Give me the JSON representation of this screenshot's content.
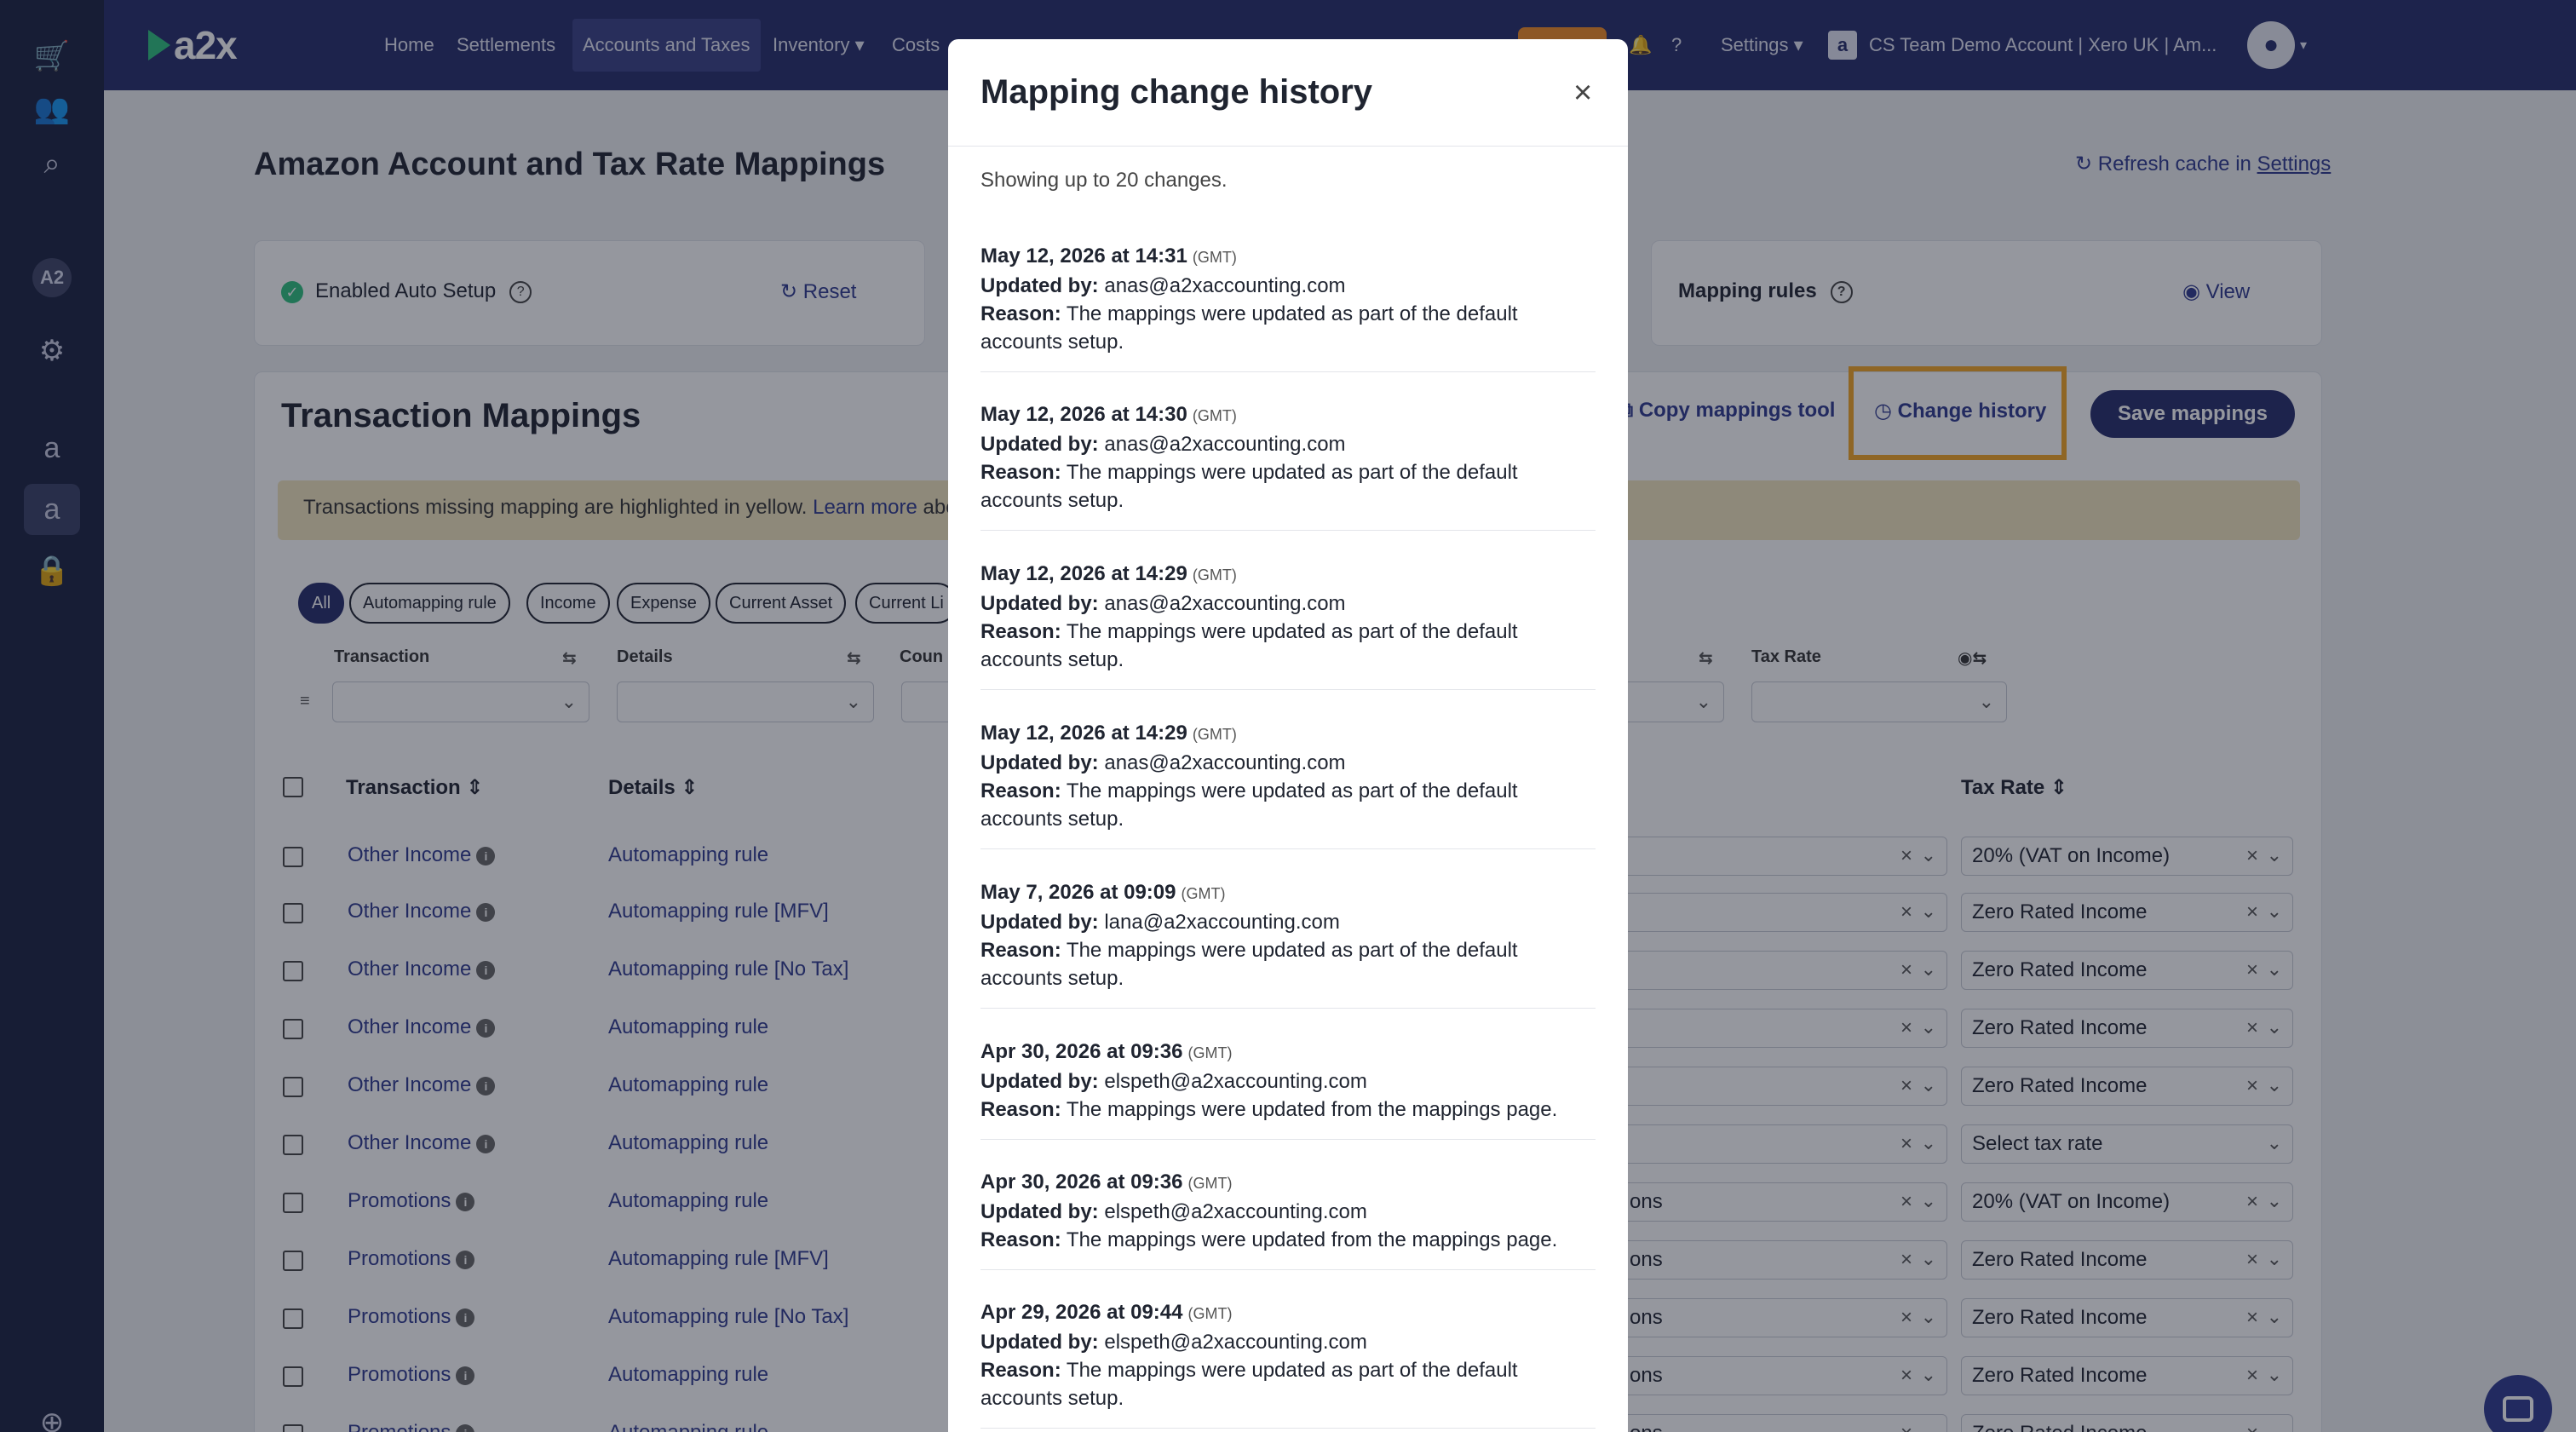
{
  "rail": {
    "icons": [
      "cart-icon",
      "users-icon",
      "search-icon",
      "a2-badge",
      "gear-icon",
      "amazon-icon",
      "amazon-store-icon",
      "lock-icon",
      "add-icon"
    ],
    "badge_label": "A2"
  },
  "nav": {
    "logo": "a2x",
    "items": [
      "Home",
      "Settlements",
      "Accounts and Taxes",
      "Inventory ▾",
      "Costs"
    ],
    "settings": "Settings ▾",
    "account": "CS Team Demo Account | Xero UK | Am..."
  },
  "page": {
    "title": "Amazon Account and Tax Rate Mappings",
    "refresh_prefix": "Refresh cache in ",
    "refresh_link": "Settings"
  },
  "auto_setup": {
    "label": "Enabled Auto Setup",
    "reset": "Reset"
  },
  "mapping_rules": {
    "label": "Mapping rules",
    "view": "View"
  },
  "transaction_mappings": {
    "title": "Transaction Mappings",
    "copy_tool": "Copy mappings tool",
    "change_history": "Change history",
    "save": "Save mappings",
    "banner_text": "Transactions missing mapping are highlighted in yellow. ",
    "banner_link": "Learn more",
    "banner_tail": " abo",
    "pills": [
      "All",
      "Automapping rule",
      "Income",
      "Expense",
      "Current Asset",
      "Current Li"
    ],
    "filters": {
      "transaction": "Transaction",
      "details": "Details",
      "count": "Coun",
      "tax_rate": "Tax Rate"
    },
    "columns": {
      "transaction": "Transaction",
      "details": "Details",
      "tax_rate": "Tax Rate"
    },
    "rows": [
      {
        "transaction": "Other Income",
        "details": "Automapping rule",
        "account_tail": "",
        "tax": "20% (VAT on Income)"
      },
      {
        "transaction": "Other Income",
        "details": "Automapping rule [MFV]",
        "account_tail": "",
        "tax": "Zero Rated Income"
      },
      {
        "transaction": "Other Income",
        "details": "Automapping rule [No Tax]",
        "account_tail": "",
        "tax": "Zero Rated Income"
      },
      {
        "transaction": "Other Income",
        "details": "Automapping rule",
        "account_tail": "",
        "tax": "Zero Rated Income"
      },
      {
        "transaction": "Other Income",
        "details": "Automapping rule",
        "account_tail": "",
        "tax": "Zero Rated Income"
      },
      {
        "transaction": "Other Income",
        "details": "Automapping rule",
        "account_tail": "",
        "tax": "Select tax rate"
      },
      {
        "transaction": "Promotions",
        "details": "Automapping rule",
        "account_tail": "ons",
        "tax": "20% (VAT on Income)"
      },
      {
        "transaction": "Promotions",
        "details": "Automapping rule [MFV]",
        "account_tail": "ons",
        "tax": "Zero Rated Income"
      },
      {
        "transaction": "Promotions",
        "details": "Automapping rule [No Tax]",
        "account_tail": "ons",
        "tax": "Zero Rated Income"
      },
      {
        "transaction": "Promotions",
        "details": "Automapping rule",
        "account_tail": "ons",
        "tax": "Zero Rated Income"
      },
      {
        "transaction": "Promotions",
        "details": "Automapping rule",
        "account_tail": "ons",
        "tax": "Zero Rated Income"
      }
    ]
  },
  "modal": {
    "title": "Mapping change history",
    "close": "×",
    "showing": "Showing up to 20 changes.",
    "updated_by_label": "Updated by:",
    "reason_label": "Reason:",
    "gmt": "(GMT)",
    "entries": [
      {
        "date": "May 12, 2026 at 14:31",
        "user": "anas@a2xaccounting.com",
        "reason": "The mappings were updated as part of the default accounts setup."
      },
      {
        "date": "May 12, 2026 at 14:30",
        "user": "anas@a2xaccounting.com",
        "reason": "The mappings were updated as part of the default accounts setup."
      },
      {
        "date": "May 12, 2026 at 14:29",
        "user": "anas@a2xaccounting.com",
        "reason": "The mappings were updated as part of the default accounts setup."
      },
      {
        "date": "May 12, 2026 at 14:29",
        "user": "anas@a2xaccounting.com",
        "reason": "The mappings were updated as part of the default accounts setup."
      },
      {
        "date": "May 7, 2026 at 09:09",
        "user": "lana@a2xaccounting.com",
        "reason": "The mappings were updated as part of the default accounts setup."
      },
      {
        "date": "Apr 30, 2026 at 09:36",
        "user": "elspeth@a2xaccounting.com",
        "reason": "The mappings were updated from the mappings page."
      },
      {
        "date": "Apr 30, 2026 at 09:36",
        "user": "elspeth@a2xaccounting.com",
        "reason": "The mappings were updated from the mappings page."
      },
      {
        "date": "Apr 29, 2026 at 09:44",
        "user": "elspeth@a2xaccounting.com",
        "reason": "The mappings were updated as part of the default accounts setup."
      }
    ]
  }
}
